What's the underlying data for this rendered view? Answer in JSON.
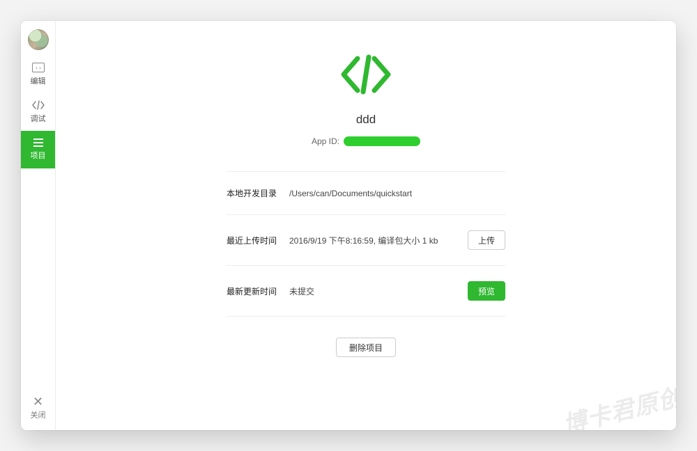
{
  "sidebar": {
    "items": [
      {
        "label": "编辑"
      },
      {
        "label": "调试"
      },
      {
        "label": "项目"
      }
    ],
    "close_label": "关闭"
  },
  "header": {
    "app_name": "ddd",
    "appid_label": "App ID:"
  },
  "details": {
    "local_dir": {
      "label": "本地开发目录",
      "value": "/Users/can/Documents/quickstart"
    },
    "last_upload": {
      "label": "最近上传时间",
      "value": "2016/9/19 下午8:16:59, 编译包大小 1 kb",
      "button": "上传"
    },
    "last_update": {
      "label": "最新更新时间",
      "value": "未提交",
      "button": "预览"
    }
  },
  "actions": {
    "delete_project": "删除项目"
  },
  "watermark": "博卡君原创"
}
